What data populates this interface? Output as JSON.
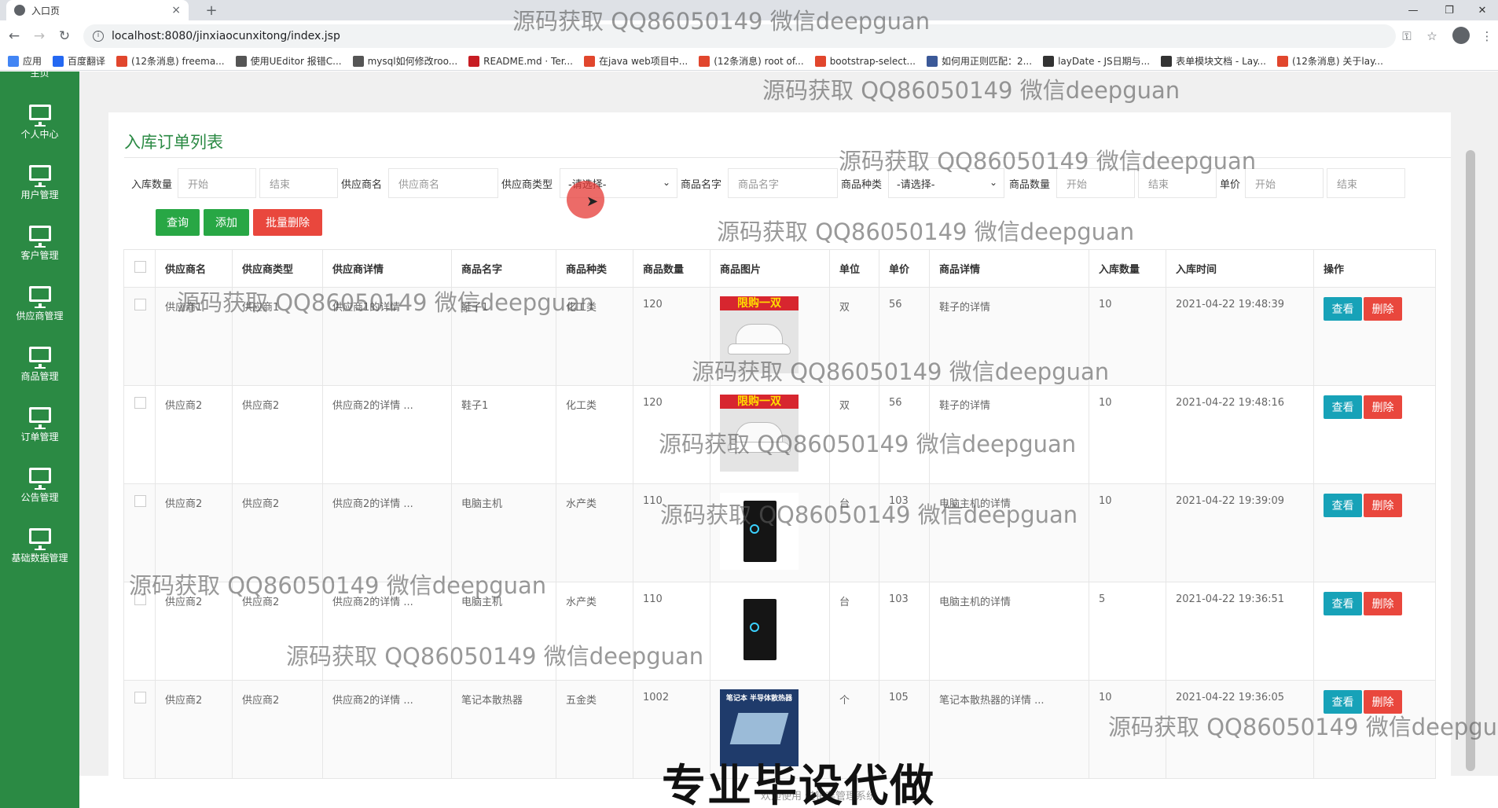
{
  "browser": {
    "tab_title": "入口页",
    "tab_close": "×",
    "new_tab": "+",
    "url": "localhost:8080/jinxiaocunxitong/index.jsp",
    "bookmarks": [
      {
        "label": "应用",
        "color": "#4285f4"
      },
      {
        "label": "百度翻译",
        "color": "#2468f2"
      },
      {
        "label": "(12条消息) freema...",
        "color": "#e1462d"
      },
      {
        "label": "使用UEditor 报错C...",
        "color": "#555555"
      },
      {
        "label": "mysql如何修改roo...",
        "color": "#555555"
      },
      {
        "label": "README.md · Ter...",
        "color": "#c71d23"
      },
      {
        "label": "在java web项目中...",
        "color": "#e1462d"
      },
      {
        "label": "(12条消息) root of...",
        "color": "#e1462d"
      },
      {
        "label": "bootstrap-select...",
        "color": "#e1462d"
      },
      {
        "label": "如何用正则匹配：2...",
        "color": "#3b5998"
      },
      {
        "label": "layDate - JS日期与...",
        "color": "#333333"
      },
      {
        "label": "表单模块文档 - Lay...",
        "color": "#333333"
      },
      {
        "label": "(12条消息) 关于lay...",
        "color": "#e1462d"
      }
    ]
  },
  "sidebar": {
    "top_partial": "主页",
    "items": [
      {
        "label": "个人中心"
      },
      {
        "label": "用户管理"
      },
      {
        "label": "客户管理"
      },
      {
        "label": "供应商管理"
      },
      {
        "label": "商品管理"
      },
      {
        "label": "订单管理"
      },
      {
        "label": "公告管理"
      },
      {
        "label": "基础数据管理"
      }
    ]
  },
  "page": {
    "title": "入库订单列表"
  },
  "filters": {
    "qty_label": "入库数量",
    "qty_start_ph": "开始",
    "qty_end_ph": "结束",
    "supplier_name_label": "供应商名",
    "supplier_name_ph": "供应商名",
    "supplier_type_label": "供应商类型",
    "supplier_type_value": "-请选择-",
    "goods_name_label": "商品名字",
    "goods_name_ph": "商品名字",
    "goods_type_label": "商品种类",
    "goods_type_value": "-请选择-",
    "goods_qty_label": "商品数量",
    "goods_qty_start_ph": "开始",
    "goods_qty_end_ph": "结束",
    "price_label": "单价",
    "price_start_ph": "开始",
    "price_end_ph": "结束"
  },
  "actions": {
    "search": "查询",
    "add": "添加",
    "batch_delete": "批量删除"
  },
  "table": {
    "headers": [
      "供应商名",
      "供应商类型",
      "供应商详情",
      "商品名字",
      "商品种类",
      "商品数量",
      "商品图片",
      "单位",
      "单价",
      "商品详情",
      "入库数量",
      "入库时间",
      "操作"
    ],
    "view_label": "查看",
    "delete_label": "删除",
    "rows": [
      {
        "supplier": "供应商1",
        "supplier_type": "供应商1",
        "supplier_detail": "供应商1的详情",
        "goods": "鞋子1",
        "goods_type": "化工类",
        "goods_qty": "120",
        "image": "shoe",
        "image_banner": "限购一双",
        "unit": "双",
        "price": "56",
        "detail": "鞋子的详情",
        "in_qty": "10",
        "time": "2021-04-22 19:48:39"
      },
      {
        "supplier": "供应商2",
        "supplier_type": "供应商2",
        "supplier_detail": "供应商2的详情 ...",
        "goods": "鞋子1",
        "goods_type": "化工类",
        "goods_qty": "120",
        "image": "shoe",
        "image_banner": "限购一双",
        "unit": "双",
        "price": "56",
        "detail": "鞋子的详情",
        "in_qty": "10",
        "time": "2021-04-22 19:48:16"
      },
      {
        "supplier": "供应商2",
        "supplier_type": "供应商2",
        "supplier_detail": "供应商2的详情 ...",
        "goods": "电脑主机",
        "goods_type": "水产类",
        "goods_qty": "110",
        "image": "pc",
        "image_banner": "",
        "unit": "台",
        "price": "103",
        "detail": "电脑主机的详情",
        "in_qty": "10",
        "time": "2021-04-22 19:39:09"
      },
      {
        "supplier": "供应商2",
        "supplier_type": "供应商2",
        "supplier_detail": "供应商2的详情 ...",
        "goods": "电脑主机",
        "goods_type": "水产类",
        "goods_qty": "110",
        "image": "pc",
        "image_banner": "",
        "unit": "台",
        "price": "103",
        "detail": "电脑主机的详情",
        "in_qty": "5",
        "time": "2021-04-22 19:36:51"
      },
      {
        "supplier": "供应商2",
        "supplier_type": "供应商2",
        "supplier_detail": "供应商2的详情 ...",
        "goods": "笔记本散热器",
        "goods_type": "五金类",
        "goods_qty": "1002",
        "image": "cooler",
        "image_banner": "笔记本 半导体散热器",
        "unit": "个",
        "price": "105",
        "detail": "笔记本散热器的详情 ...",
        "in_qty": "10",
        "time": "2021-04-22 19:36:05"
      }
    ]
  },
  "watermarks": {
    "text": "源码获取 QQ86050149 微信deepguan",
    "text_cut": "源码获取 QQ86050149 微信deepgu",
    "big": "专业毕设代做",
    "footer": "欢迎使用 进销存管理系统"
  },
  "colors": {
    "sidebar": "#2b8a44",
    "title": "#2b8a44",
    "btn_green": "#28a745",
    "btn_red": "#e9473d",
    "btn_view": "#17a2b8"
  }
}
